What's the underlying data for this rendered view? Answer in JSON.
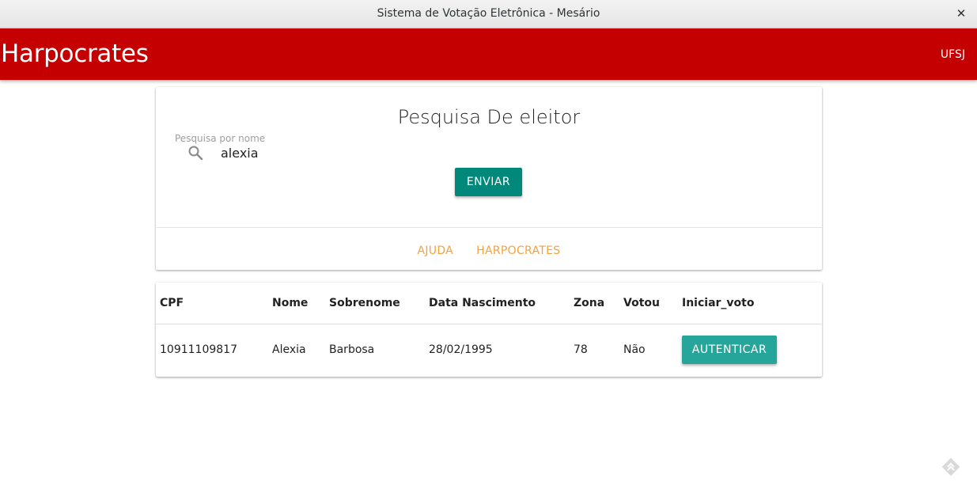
{
  "window": {
    "title": "Sistema de Votação Eletrônica - Mesário",
    "close_glyph": "✕"
  },
  "appbar": {
    "brand": "Harpocrates",
    "right_link": "UFSJ",
    "color": "#c40000"
  },
  "search": {
    "title": "Pesquisa De eleitor",
    "field_label": "Pesquisa por nome",
    "value": "alexia",
    "icon": "search-icon",
    "submit_label": "ENVIAR",
    "actions": [
      "AJUDA",
      "HARPOCRATES"
    ]
  },
  "table": {
    "headers": [
      "CPF",
      "Nome",
      "Sobrenome",
      "Data Nascimento",
      "Zona",
      "Votou",
      "Iniciar_voto"
    ],
    "rows": [
      {
        "cpf": "10911109817",
        "nome": "Alexia",
        "sobrenome": "Barbosa",
        "data_nascimento": "28/02/1995",
        "zona": "78",
        "votou": "Não",
        "action_label": "AUTENTICAR"
      }
    ]
  },
  "colors": {
    "submit_button": "#00897b",
    "auth_button": "#26a69a",
    "action_links": "#f2a23c"
  }
}
